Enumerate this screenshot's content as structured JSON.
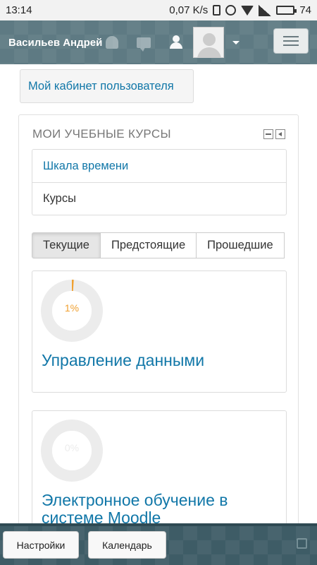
{
  "status_bar": {
    "time": "13:14",
    "network_speed": "0,07 K/s",
    "battery_level": "74"
  },
  "navbar": {
    "username": "Васильев Андрей"
  },
  "cabinet_button": "Мой кабинет пользователя",
  "block": {
    "title": "МОИ УЧЕБНЫЕ КУРСЫ",
    "nav_items": [
      {
        "label": "Шкала времени",
        "link": true
      },
      {
        "label": "Курсы",
        "link": false
      }
    ],
    "tabs": [
      {
        "label": "Текущие",
        "active": true
      },
      {
        "label": "Предстоящие",
        "active": false
      },
      {
        "label": "Прошедшие",
        "active": false
      }
    ],
    "courses": [
      {
        "title": "Управление данными",
        "progress_label": "1%",
        "progress": 0.01
      },
      {
        "title": "Электронное обучение в системе Moodle",
        "progress_label": "0%",
        "progress": 0
      }
    ]
  },
  "bottom_bar": {
    "settings_label": "Настройки",
    "calendar_label": "Календарь"
  },
  "colors": {
    "navbar": "#5e7a83",
    "link": "#1177a8",
    "progress": "#f0a030",
    "donut_track": "#ececec"
  }
}
